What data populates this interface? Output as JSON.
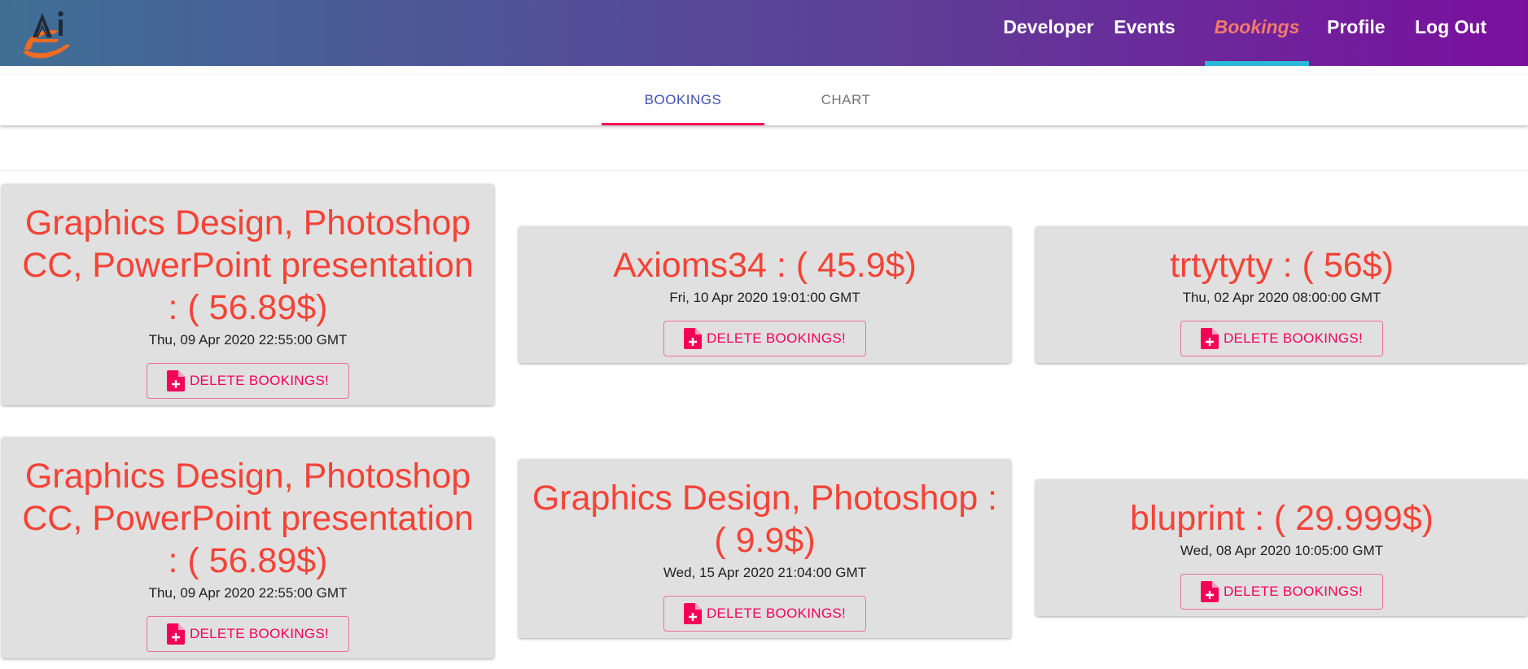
{
  "header": {
    "logo_text": "Ai",
    "nav": [
      {
        "label": "Developer"
      },
      {
        "label": "Events"
      },
      {
        "label": "Bookings"
      },
      {
        "label": "Profile"
      },
      {
        "label": "Log Out"
      }
    ],
    "active_nav": "Bookings"
  },
  "tabs": [
    {
      "label": "BOOKINGS"
    },
    {
      "label": "CHART"
    }
  ],
  "active_tab": "BOOKINGS",
  "bookings": [
    {
      "title": "Graphics Design, Photoshop CC, PowerPoint presentation : ( 56.89$)",
      "date": "Thu, 09 Apr 2020 22:55:00 GMT",
      "button": "DELETE BOOKINGS!"
    },
    {
      "title": "Axioms34 : ( 45.9$)",
      "date": "Fri, 10 Apr 2020 19:01:00 GMT",
      "button": "DELETE BOOKINGS!"
    },
    {
      "title": "trtytyty : ( 56$)",
      "date": "Thu, 02 Apr 2020 08:00:00 GMT",
      "button": "DELETE BOOKINGS!"
    },
    {
      "title": "Graphics Design, Photoshop CC, PowerPoint presentation : ( 56.89$)",
      "date": "Thu, 09 Apr 2020 22:55:00 GMT",
      "button": "DELETE BOOKINGS!"
    },
    {
      "title": "Graphics Design, Photoshop : ( 9.9$)",
      "date": "Wed, 15 Apr 2020 21:04:00 GMT",
      "button": "DELETE BOOKINGS!"
    },
    {
      "title": "bluprint : ( 29.999$)",
      "date": "Wed, 08 Apr 2020 10:05:00 GMT",
      "button": "DELETE BOOKINGS!"
    }
  ],
  "colors": {
    "accent": "#f50057",
    "title_red": "#f44336",
    "tab_active": "#3f51b5",
    "nav_active": "#f07a6c",
    "nav_underline": "#2bb8d4",
    "card_bg": "#e0e0e0"
  },
  "icons": {
    "delete_button_icon": "note-add-icon"
  }
}
